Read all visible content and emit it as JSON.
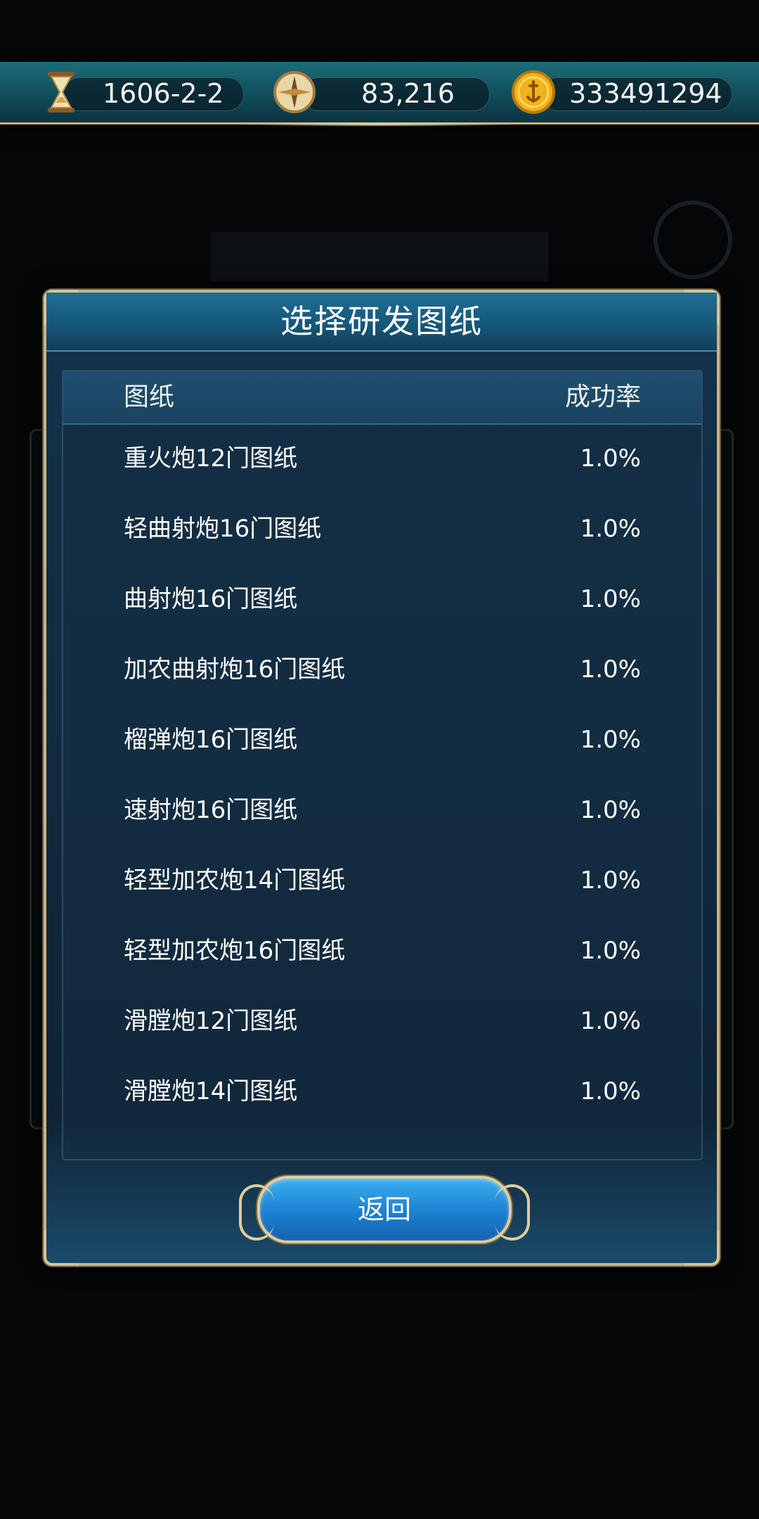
{
  "resources": {
    "date": "1606-2-2",
    "compass_value": "83,216",
    "gold": "333491294"
  },
  "icons": {
    "date": "hourglass-icon",
    "compass": "compass-icon",
    "gold": "gold-coin-icon"
  },
  "dialog": {
    "title": "选择研发图纸",
    "col_blueprint": "图纸",
    "col_success_rate": "成功率",
    "rows": [
      {
        "name": "重火炮12门图纸",
        "rate": "1.0%"
      },
      {
        "name": "轻曲射炮16门图纸",
        "rate": "1.0%"
      },
      {
        "name": "曲射炮16门图纸",
        "rate": "1.0%"
      },
      {
        "name": "加农曲射炮16门图纸",
        "rate": "1.0%"
      },
      {
        "name": "榴弹炮16门图纸",
        "rate": "1.0%"
      },
      {
        "name": "速射炮16门图纸",
        "rate": "1.0%"
      },
      {
        "name": "轻型加农炮14门图纸",
        "rate": "1.0%"
      },
      {
        "name": "轻型加农炮16门图纸",
        "rate": "1.0%"
      },
      {
        "name": "滑膛炮12门图纸",
        "rate": "1.0%"
      },
      {
        "name": "滑膛炮14门图纸",
        "rate": "1.0%"
      }
    ],
    "back_label": "返回"
  },
  "colors": {
    "accent_gold": "#c8b38a",
    "button_blue": "#1b7fd0",
    "header_teal": "#1d6d7a"
  }
}
